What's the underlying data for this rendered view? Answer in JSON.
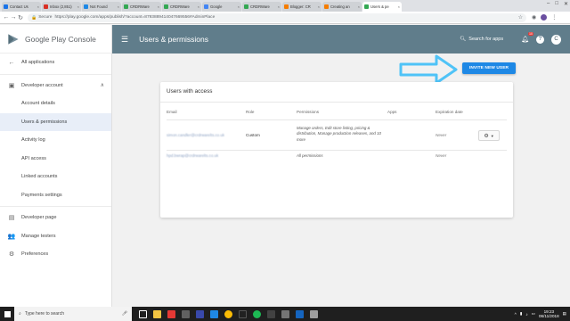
{
  "browser": {
    "tabs": [
      {
        "label": "Contact Us",
        "color": "#1a73e8"
      },
      {
        "label": "Inbox (2,851)",
        "color": "#d93025"
      },
      {
        "label": "Not Found",
        "color": "#1e88e5"
      },
      {
        "label": "CRDRWare",
        "color": "#34a853"
      },
      {
        "label": "CRDRWare",
        "color": "#34a853"
      },
      {
        "label": "Google",
        "color": "#4285f4"
      },
      {
        "label": "CRDRWare",
        "color": "#34a853"
      },
      {
        "label": "Blogger: CR",
        "color": "#f57c00"
      },
      {
        "label": "Creating an",
        "color": "#f57c00"
      },
      {
        "label": "Users & pe",
        "color": "#34a853",
        "active": true
      }
    ],
    "secure_label": "Secure",
    "url": "https://play.google.com/apps/publish/?account=8793889414047669556#AdminPlace"
  },
  "sidebar": {
    "brand": "Google Play Console",
    "items": [
      {
        "label": "All applications",
        "icon": "arrow-back-icon"
      },
      {
        "label": "Developer account",
        "icon": "account-box-icon"
      },
      {
        "label": "Account details"
      },
      {
        "label": "Users & permissions"
      },
      {
        "label": "Activity log"
      },
      {
        "label": "API access"
      },
      {
        "label": "Linked accounts"
      },
      {
        "label": "Payments settings"
      },
      {
        "label": "Developer page",
        "icon": "web-icon"
      },
      {
        "label": "Manage testers",
        "icon": "group-icon"
      },
      {
        "label": "Preferences",
        "icon": "settings-icon"
      }
    ]
  },
  "appbar": {
    "title": "Users & permissions",
    "search_label": "Search for apps",
    "notif_count": "10",
    "account_initial": "C"
  },
  "main": {
    "invite_button": "INVITE NEW USER",
    "card_title": "Users with access",
    "columns": [
      "Email",
      "Role",
      "Permissions",
      "Apps",
      "Expiration date"
    ],
    "rows": [
      {
        "email": "simon.candler@crdrwarelts.co.uk",
        "role": "Custom",
        "permissions": "Manage orders, Edit store listing, pricing & distribution, Manage production releases, and 10 more",
        "apps": "",
        "expiration": "Never"
      },
      {
        "email": "hpd.bwrap@crdrwarelts.co.uk",
        "role": "",
        "permissions": "All permissions",
        "apps": "",
        "expiration": "Never"
      }
    ]
  },
  "taskbar": {
    "search_placeholder": "Type here to search",
    "time": "19:23",
    "date": "06/11/2018"
  },
  "colors": {
    "appbar": "#607d8b",
    "accent": "#1e88e5",
    "arrow": "#4fc3f7"
  }
}
